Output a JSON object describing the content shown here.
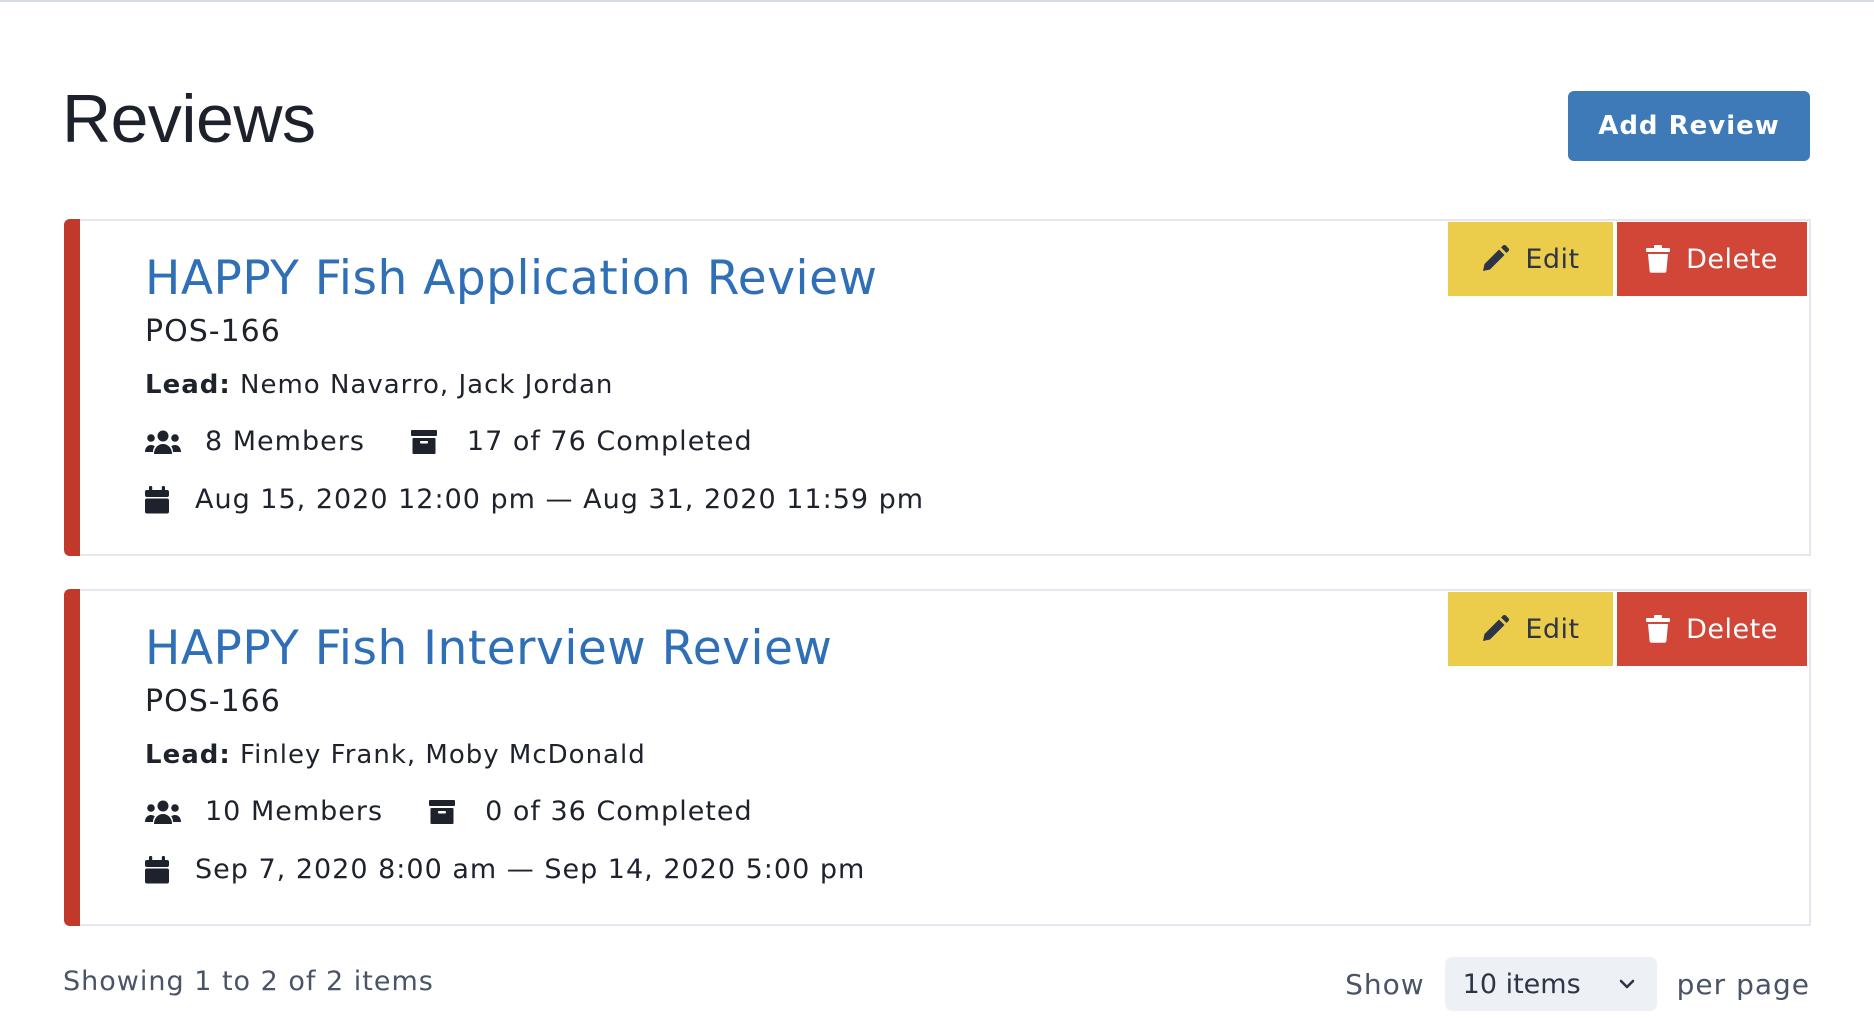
{
  "header": {
    "title": "Reviews",
    "add_button": "Add Review"
  },
  "colors": {
    "accent_blue": "#3e79b8",
    "link_blue": "#2e6fb7",
    "card_accent_red": "#c0392b",
    "edit_yellow": "#ebcd4b",
    "delete_red": "#d24637"
  },
  "reviews": [
    {
      "title": "HAPPY Fish Application Review",
      "code": "POS-166",
      "lead_label": "Lead:",
      "leads": "Nemo Navarro, Jack Jordan",
      "members": "8 Members",
      "completed": "17 of 76 Completed",
      "date_range": "Aug 15, 2020 12:00 pm — Aug 31, 2020 11:59 pm",
      "edit_label": "Edit",
      "delete_label": "Delete"
    },
    {
      "title": "HAPPY Fish Interview Review",
      "code": "POS-166",
      "lead_label": "Lead:",
      "leads": "Finley Frank, Moby McDonald",
      "members": "10 Members",
      "completed": "0 of 36 Completed",
      "date_range": "Sep 7, 2020 8:00 am — Sep 14, 2020 5:00 pm",
      "edit_label": "Edit",
      "delete_label": "Delete"
    }
  ],
  "icons": {
    "members": "users-icon",
    "completed": "archive-box-icon",
    "dates": "calendar-icon",
    "edit": "pencil-icon",
    "delete": "trash-icon",
    "select": "chevron-down-icon"
  },
  "footer": {
    "status": "Showing 1 to 2 of 2 items",
    "show_label": "Show",
    "per_page_value": "10 items",
    "per_page_suffix": "per page"
  }
}
